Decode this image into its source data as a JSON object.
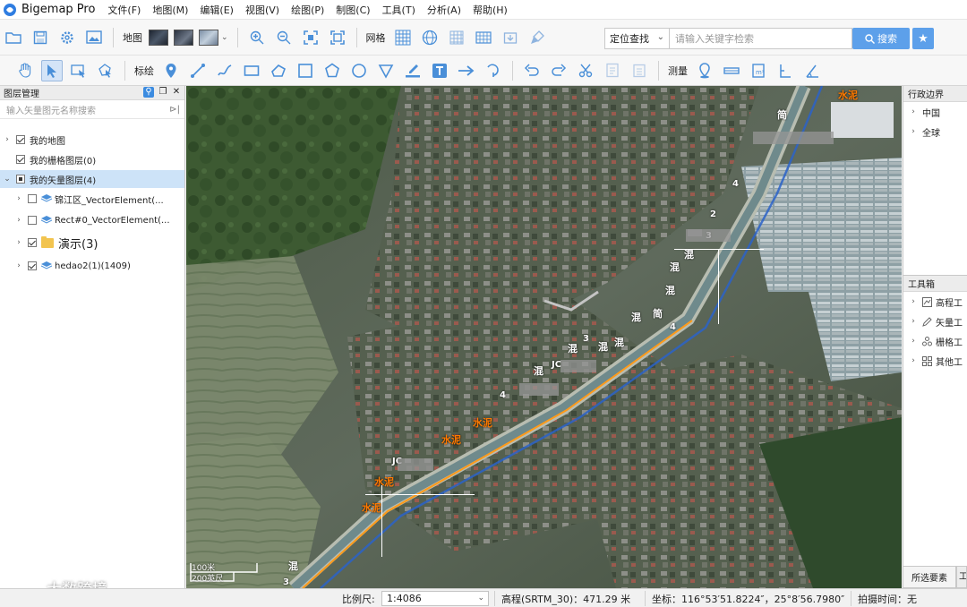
{
  "app": {
    "title": "Bigemap Pro"
  },
  "menu": [
    "文件(F)",
    "地图(M)",
    "编辑(E)",
    "视图(V)",
    "绘图(P)",
    "制图(C)",
    "工具(T)",
    "分析(A)",
    "帮助(H)"
  ],
  "toolbar1": {
    "map_label": "地图",
    "grid_label": "网格",
    "locate_select": "定位查找",
    "search_placeholder": "请输入关键字检索",
    "search_button": "搜索"
  },
  "toolbar2": {
    "annotate_label": "标绘",
    "measure_label": "测量"
  },
  "layer_panel": {
    "title": "图层管理",
    "filter_placeholder": "输入矢量图元名称搜索",
    "items": [
      {
        "label": "我的地图"
      },
      {
        "label": "我的栅格图层(0)"
      },
      {
        "label": "我的矢量图层(4)"
      },
      {
        "label": "锦江区_VectorElement(..."
      },
      {
        "label": "Rect#0_VectorElement(..."
      },
      {
        "label": "演示(3)"
      },
      {
        "label": "hedao2(1)(1409)"
      }
    ]
  },
  "map": {
    "labels": [
      "水泥",
      "水泥",
      "水泥",
      "水泥",
      "水泥",
      "混",
      "混",
      "混",
      "混",
      "混",
      "混",
      "混",
      "混",
      "简",
      "简",
      "JC",
      "JC",
      "4",
      "4",
      "4",
      "2",
      "3",
      "3",
      "3"
    ],
    "scale_top": "100米",
    "scale_bottom": "200英尺",
    "watermark": "大数跨境"
  },
  "admin_panel": {
    "title": "行政边界",
    "items": [
      "中国",
      "全球"
    ]
  },
  "toolbox_panel": {
    "title": "工具箱",
    "items": [
      "高程工",
      "矢量工",
      "栅格工",
      "其他工"
    ]
  },
  "bottom_tabs": {
    "selected_elements": "所选要素",
    "other": "工"
  },
  "status": {
    "scale_label": "比例尺:",
    "scale_value": "1:4086",
    "elevation": "高程(SRTM_30)：471.29 米",
    "coordinate": "坐标：116°53′51.8224″，25°8′56.7980″",
    "capture_time": "拍摄时间：无"
  },
  "colors": {
    "accent": "#5da0ea",
    "selected": "#cde3f8",
    "route_label": "#ff7a00"
  }
}
